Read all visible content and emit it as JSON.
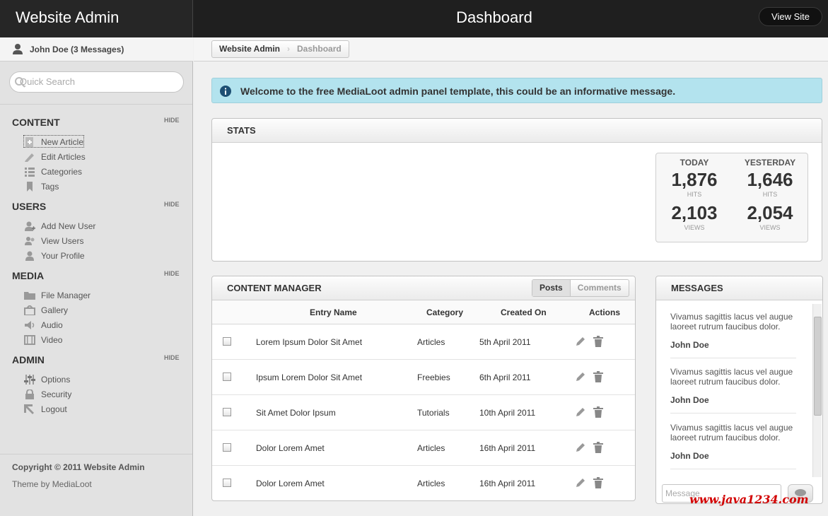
{
  "header": {
    "brand": "Website Admin",
    "title": "Dashboard",
    "view_site": "View Site"
  },
  "user": {
    "label": "John Doe (3 Messages)"
  },
  "search": {
    "placeholder": "Quick Search"
  },
  "sidebar": {
    "hide_label": "HIDE",
    "sections": [
      {
        "title": "CONTENT",
        "items": [
          "New Article",
          "Edit Articles",
          "Categories",
          "Tags"
        ]
      },
      {
        "title": "USERS",
        "items": [
          "Add New User",
          "View Users",
          "Your Profile"
        ]
      },
      {
        "title": "MEDIA",
        "items": [
          "File Manager",
          "Gallery",
          "Audio",
          "Video"
        ]
      },
      {
        "title": "ADMIN",
        "items": [
          "Options",
          "Security",
          "Logout"
        ]
      }
    ],
    "copyright": "Copyright © 2011 Website Admin",
    "theme": "Theme by MediaLoot"
  },
  "breadcrumb": [
    "Website Admin",
    "Dashboard"
  ],
  "info_message": "Welcome to the free MediaLoot admin panel template, this could be an informative message.",
  "stats": {
    "title": "STATS",
    "today": {
      "label": "TODAY",
      "hits": "1,876",
      "views": "2,103"
    },
    "yesterday": {
      "label": "YESTERDAY",
      "hits": "1,646",
      "views": "2,054"
    },
    "hits_label": "HITS",
    "views_label": "VIEWS"
  },
  "content_manager": {
    "title": "CONTENT MANAGER",
    "tabs": [
      "Posts",
      "Comments"
    ],
    "columns": [
      "Entry Name",
      "Category",
      "Created On",
      "Actions"
    ],
    "rows": [
      {
        "name": "Lorem Ipsum Dolor Sit Amet",
        "category": "Articles",
        "date": "5th April 2011"
      },
      {
        "name": "Ipsum Lorem Dolor Sit Amet",
        "category": "Freebies",
        "date": "6th April 2011"
      },
      {
        "name": "Sit Amet Dolor Ipsum",
        "category": "Tutorials",
        "date": "10th April 2011"
      },
      {
        "name": "Dolor Lorem Amet",
        "category": "Articles",
        "date": "16th April 2011"
      },
      {
        "name": "Dolor Lorem Amet",
        "category": "Articles",
        "date": "16th April 2011"
      }
    ]
  },
  "messages": {
    "title": "MESSAGES",
    "items": [
      {
        "text": "Vivamus sagittis lacus vel augue laoreet rutrum faucibus dolor.",
        "author": "John Doe"
      },
      {
        "text": "Vivamus sagittis lacus vel augue laoreet rutrum faucibus dolor.",
        "author": "John Doe"
      },
      {
        "text": "Vivamus sagittis lacus vel augue laoreet rutrum faucibus dolor.",
        "author": "John Doe"
      }
    ],
    "input_placeholder": "Message"
  },
  "watermark": "www.java1234.com"
}
